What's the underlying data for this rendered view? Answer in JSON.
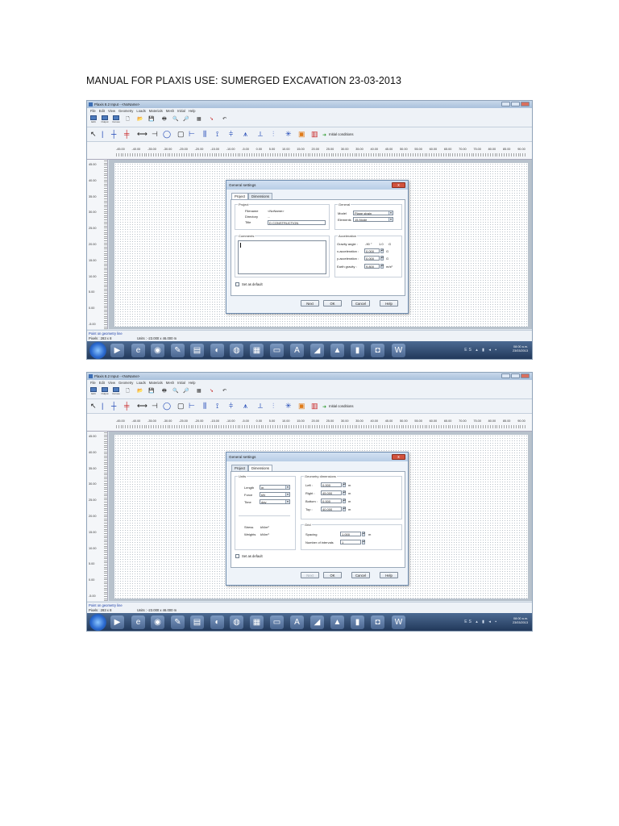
{
  "document": {
    "title": "MANUAL FOR PLAXIS USE: SUMERGED EXCAVATION 23-03-2013"
  },
  "window": {
    "title": "Plaxis 8.2 Input - <NoName>",
    "menu": [
      "File",
      "Edit",
      "View",
      "Geometry",
      "Loads",
      "Materials",
      "Mesh",
      "Initial",
      "Help"
    ],
    "toolbar1_labels": [
      "Edit",
      "Output",
      "Curves"
    ],
    "toolbar2_label": "Initial conditions",
    "ruler_x": [
      "-45.00",
      "-40.00",
      "-35.00",
      "-30.00",
      "-25.00",
      "-20.00",
      "-15.00",
      "-10.00",
      "-5.00",
      "0.00",
      "5.00",
      "10.00",
      "15.00",
      "20.00",
      "25.00",
      "30.00",
      "35.00",
      "40.00",
      "45.00",
      "50.00",
      "55.00",
      "60.00",
      "65.00",
      "70.00",
      "75.00",
      "80.00",
      "85.00",
      "90.00"
    ],
    "ruler_y": [
      "45.00",
      "40.00",
      "35.00",
      "30.00",
      "25.00",
      "20.00",
      "15.00",
      "10.00",
      "5.00",
      "0.00",
      "-5.00"
    ],
    "status_prompt": "Point on geometry line",
    "status_pixels": "Pixels : 283 x 8",
    "status_units": "Units : -23.000 x 46.000 m",
    "clock_time": "08:00 a.m.",
    "clock_date": "23/03/2013",
    "tray_language": "ES"
  },
  "dialog": {
    "title": "General settings",
    "tabs": [
      "Project",
      "Dimensions"
    ],
    "close_glyph": "x",
    "set_default_label": "Set as default",
    "buttons": {
      "next": "Next",
      "ok": "OK",
      "cancel": "Cancel",
      "help": "Help"
    }
  },
  "project_tab": {
    "project_group": "Project",
    "filename_label": "Filename",
    "filename_value": "<NoName>",
    "directory_label": "Directory",
    "directory_value": "...",
    "title_label": "Title",
    "title_value": "D CONSTRUCTION",
    "general_group": "General",
    "model_label": "Model",
    "model_value": "Plane strain",
    "elements_label": "Elements",
    "elements_value": "15-Node",
    "comments_group": "Comments",
    "acceleration_group": "Acceleration",
    "gravity_angle_label": "Gravity angle :",
    "gravity_angle_value": "-90 °",
    "gravity_g_value": "1.0",
    "gravity_g_unit": "G",
    "x_acc_label": "x-acceleration :",
    "x_acc_value": "0.000",
    "y_acc_label": "y-acceleration :",
    "y_acc_value": "0.000",
    "acc_unit": "G",
    "earth_gravity_label": "Earth gravity :",
    "earth_gravity_value": "9.800",
    "earth_gravity_unit": "m/s²"
  },
  "dimensions_tab": {
    "units_group": "Units",
    "length_label": "Length",
    "length_value": "m",
    "force_label": "Force",
    "force_value": "kN",
    "time_label": "Time",
    "time_value": "day",
    "stress_label": "Stress",
    "stress_value": "kN/m²",
    "weights_label": "Weights",
    "weights_value": "kN/m³",
    "geometry_group": "Geometry dimensions",
    "left_label": "Left :",
    "left_value": "0.000",
    "right_label": "Right :",
    "right_value": "45.000",
    "bottom_label": "Bottom :",
    "bottom_value": "0.000",
    "top_label": "Top :",
    "top_value": "40.000",
    "dim_unit": "m",
    "grid_group": "Grid",
    "spacing_label": "Spacing",
    "spacing_value": "1.000",
    "spacing_unit": "m",
    "intervals_label": "Number of intervals",
    "intervals_value": "1"
  }
}
